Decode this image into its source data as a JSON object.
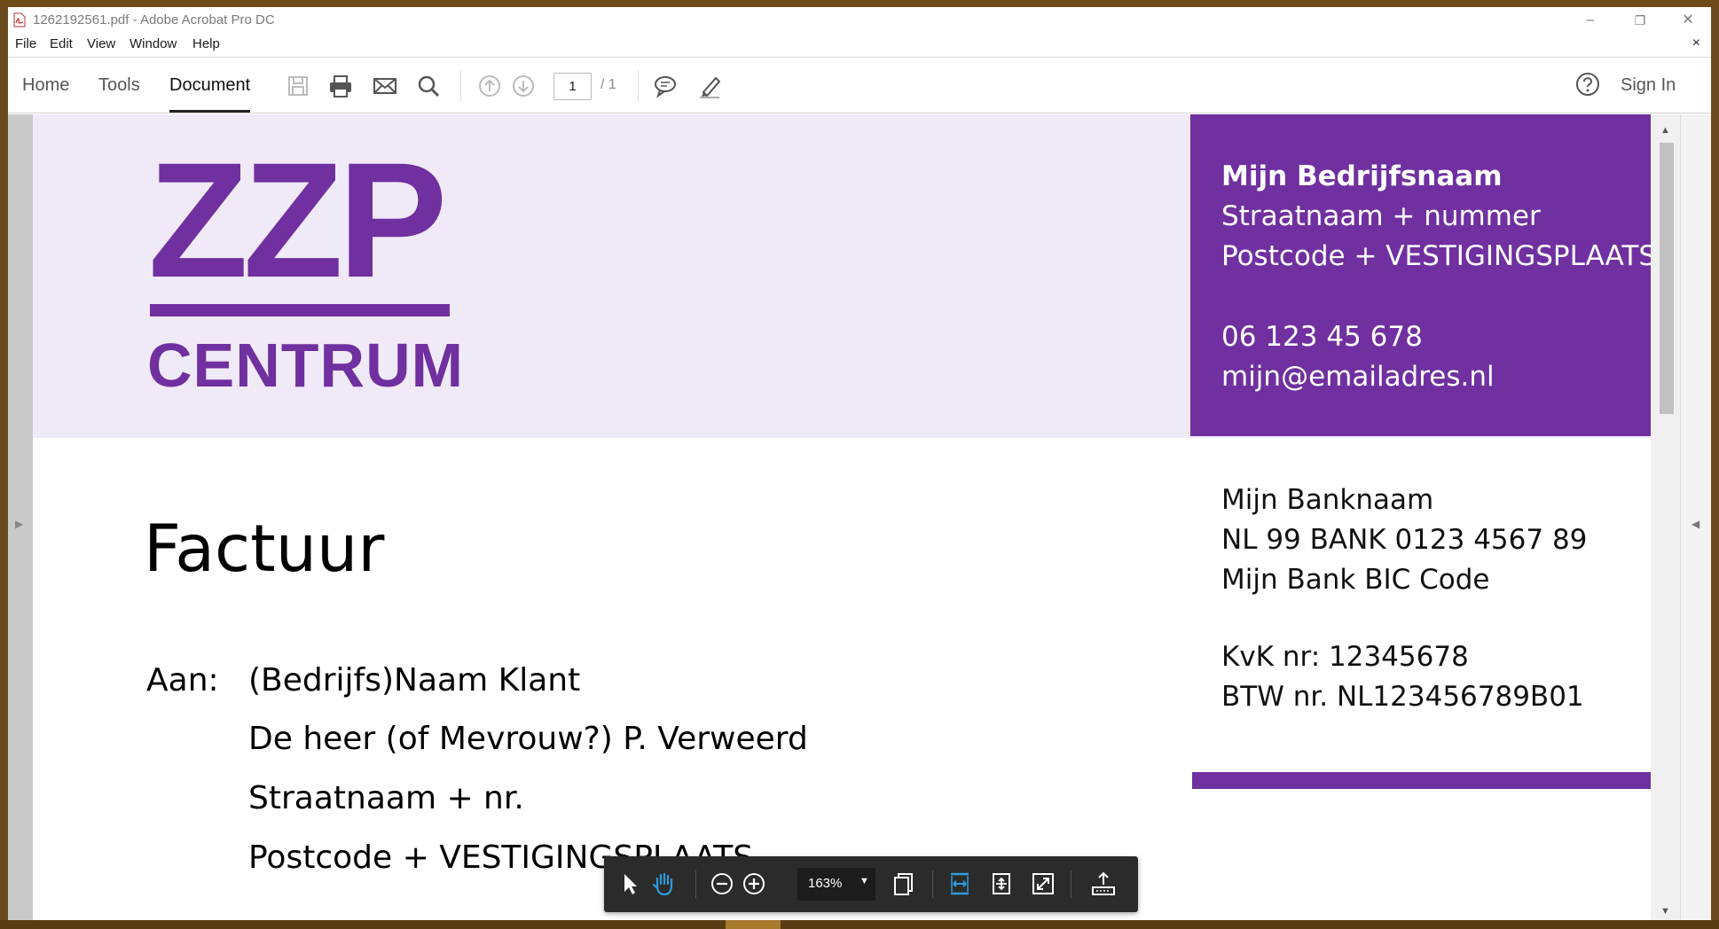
{
  "window": {
    "title": "1262192561.pdf - Adobe Acrobat Pro DC",
    "minimize": "–",
    "restore": "❐",
    "close": "✕"
  },
  "menu": {
    "items": [
      "File",
      "Edit",
      "View",
      "Window",
      "Help"
    ],
    "close_doc": "×"
  },
  "toolbar": {
    "tabs": [
      "Home",
      "Tools",
      "Document"
    ],
    "active_tab": "Document",
    "page_current": "1",
    "page_total": "/ 1",
    "sign_in": "Sign In"
  },
  "document": {
    "logo": {
      "main": "ZZP",
      "sub": "CENTRUM"
    },
    "company": {
      "name": "Mijn Bedrijfsnaam",
      "street": "Straatnaam + nummer",
      "city": "Postcode + VESTIGINGSPLAATS",
      "phone": "06 123 45 678",
      "email": "mijn@emailadres.nl"
    },
    "bank": {
      "name": "Mijn Banknaam",
      "iban": "NL 99 BANK 0123 4567 89",
      "bic": "Mijn Bank BIC Code",
      "kvk": "KvK nr: 12345678",
      "btw": "BTW nr. NL123456789B01"
    },
    "title": "Factuur",
    "recipient": {
      "label": "Aan:",
      "company": "(Bedrijfs)Naam Klant",
      "contact": "De heer (of Mevrouw?) P. Verweerd",
      "street": "Straatnaam + nr.",
      "city": "Postcode +  VESTIGINGSPLAATS"
    }
  },
  "float_toolbar": {
    "zoom": "163%"
  },
  "colors": {
    "brand_purple": "#7030a0",
    "header_band": "#f0e9f7",
    "accent_blue": "#2d9cdb"
  }
}
